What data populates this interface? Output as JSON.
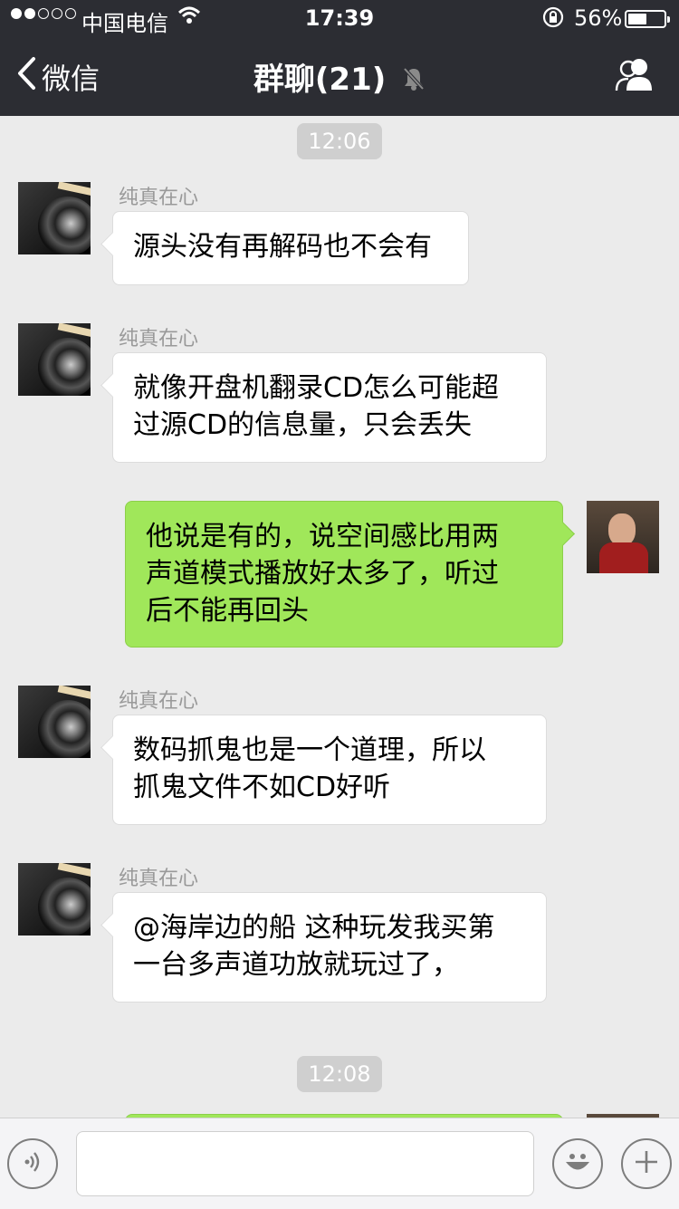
{
  "status_bar": {
    "carrier": "中国电信",
    "time": "17:39",
    "battery": "56%",
    "battery_level": 0.56
  },
  "nav": {
    "back_label": "微信",
    "title": "群聊(21)"
  },
  "messages": [
    {
      "type": "time",
      "text": "12:06"
    },
    {
      "type": "in",
      "sender": "纯真在心",
      "text": "源头没有再解码也不会有"
    },
    {
      "type": "in",
      "sender": "纯真在心",
      "lines": [
        "就像开盘机翻录CD怎么可能超",
        "过源CD的信息量，只会丢失"
      ]
    },
    {
      "type": "out",
      "lines": [
        "他说是有的，说空间感比用两",
        "声道模式播放好太多了，听过",
        "后不能再回头"
      ]
    },
    {
      "type": "in",
      "sender": "纯真在心",
      "lines": [
        "数码抓鬼也是一个道理，所以",
        "抓鬼文件不如CD好听"
      ]
    },
    {
      "type": "in",
      "sender": "纯真在心",
      "lines": [
        "@海岸边的船 这种玩发我买第",
        "一台多声道功放就玩过了，"
      ]
    },
    {
      "type": "time",
      "text": "12:08"
    }
  ],
  "icons": {
    "back": "chevron-left-icon",
    "mute": "bell-muted-icon",
    "members": "group-members-icon",
    "voice": "voice-icon",
    "emoji": "emoji-icon",
    "more": "plus-icon"
  },
  "colors": {
    "nav_bg": "#2c2d33",
    "outgoing_bubble": "#a0e75a",
    "incoming_bubble": "#ffffff",
    "chat_bg": "#ebebeb"
  }
}
